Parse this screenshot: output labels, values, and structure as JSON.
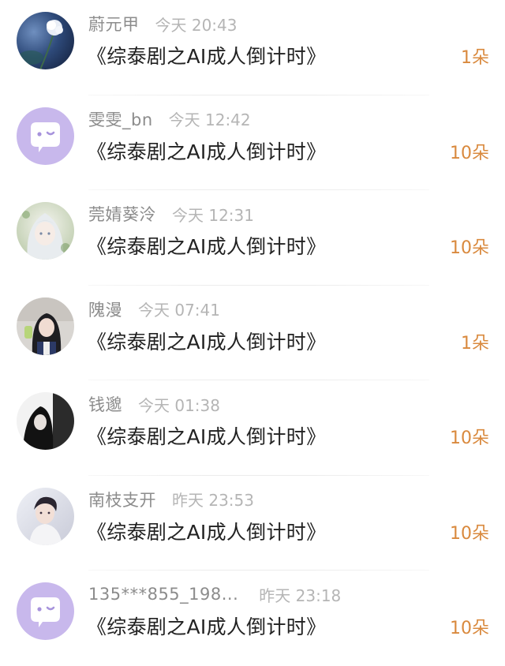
{
  "colors": {
    "name": "#8c8c8c",
    "time": "#b5b5b5",
    "title": "#222222",
    "amount": "#d9893d",
    "default_avatar_bg": "#c8b8ec"
  },
  "records": [
    {
      "user": "蔚元甲",
      "time": "今天 20:43",
      "book": "《综泰剧之AI成人倒计时》",
      "amount": "1朵",
      "avatar": "photo-flower-avatar"
    },
    {
      "user": "雯雯_bn",
      "time": "今天 12:42",
      "book": "《综泰剧之AI成人倒计时》",
      "amount": "10朵",
      "avatar": "default-chat-avatar"
    },
    {
      "user": "莞婧葵泠",
      "time": "今天 12:31",
      "book": "《综泰剧之AI成人倒计时》",
      "amount": "10朵",
      "avatar": "anime-girl-avatar"
    },
    {
      "user": "隗漫",
      "time": "今天 07:41",
      "book": "《综泰剧之AI成人倒计时》",
      "amount": "1朵",
      "avatar": "photo-girl-avatar"
    },
    {
      "user": "钱邈",
      "time": "今天 01:38",
      "book": "《综泰剧之AI成人倒计时》",
      "amount": "10朵",
      "avatar": "photo-dark-avatar"
    },
    {
      "user": "南枝支开",
      "time": "昨天 23:53",
      "book": "《综泰剧之AI成人倒计时》",
      "amount": "10朵",
      "avatar": "photo-man-avatar"
    },
    {
      "user": "135***855_198...",
      "time": "昨天 23:18",
      "book": "《综泰剧之AI成人倒计时》",
      "amount": "10朵",
      "avatar": "default-chat-avatar"
    }
  ]
}
